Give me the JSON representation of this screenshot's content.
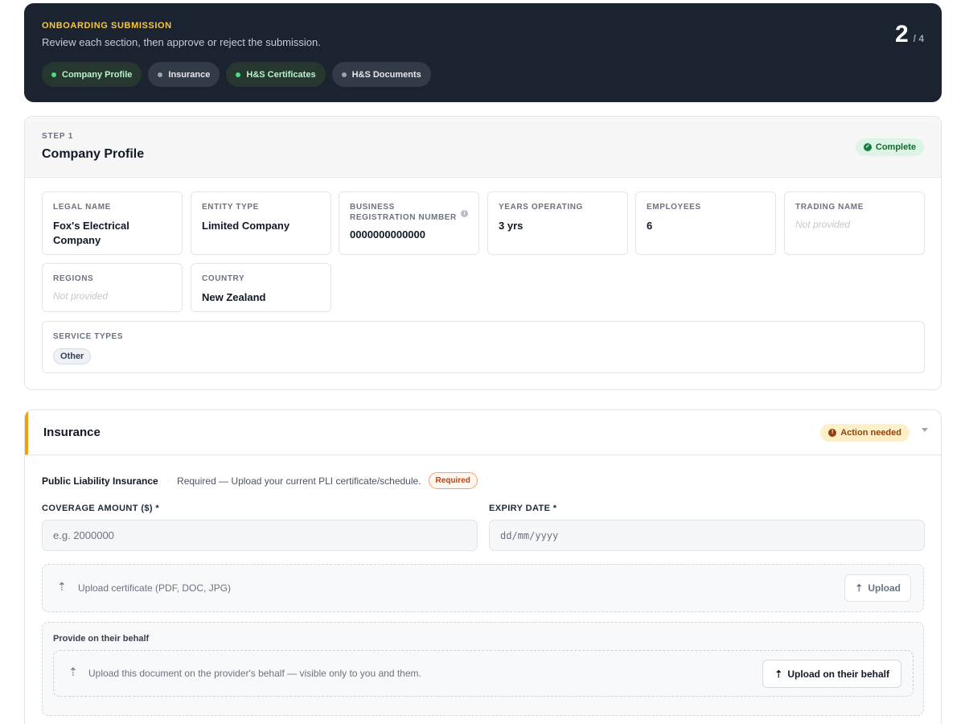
{
  "header": {
    "kicker": "ONBOARDING SUBMISSION",
    "subtitle": "Review each section, then approve or reject the submission.",
    "step_current": "2",
    "step_total": "/ 4",
    "steps": [
      {
        "label": "Company Profile",
        "status": "complete"
      },
      {
        "label": "Insurance",
        "status": "pending"
      },
      {
        "label": "H&S Certificates",
        "status": "complete"
      },
      {
        "label": "H&S Documents",
        "status": "pending"
      }
    ]
  },
  "company_profile": {
    "step_label": "STEP 1",
    "title": "Company Profile",
    "status_badge": "Complete",
    "fields": {
      "legal_name": {
        "label": "LEGAL NAME",
        "value": "Fox's Electrical Company"
      },
      "entity_type": {
        "label": "ENTITY TYPE",
        "value": "Limited Company"
      },
      "business_reg": {
        "label": "BUSINESS REGISTRATION NUMBER",
        "value": "0000000000000"
      },
      "years_operating": {
        "label": "YEARS OPERATING",
        "value": "3 yrs"
      },
      "employees": {
        "label": "EMPLOYEES",
        "value": "6"
      },
      "trading_name": {
        "label": "TRADING NAME",
        "value": "Not provided"
      },
      "regions": {
        "label": "REGIONS",
        "value": "Not provided"
      },
      "country": {
        "label": "COUNTRY",
        "value": "New Zealand"
      },
      "service_types": {
        "label": "SERVICE TYPES",
        "tags": [
          "Other"
        ]
      }
    }
  },
  "insurance": {
    "title": "Insurance",
    "status_badge": "Action needed",
    "pli": {
      "title": "Public Liability Insurance",
      "description": "Required — Upload your current PLI certificate/schedule.",
      "required_badge": "Required"
    },
    "coverage": {
      "label": "COVERAGE AMOUNT ($) *",
      "placeholder": "e.g. 2000000"
    },
    "expiry": {
      "label": "EXPIRY DATE *",
      "placeholder": "dd/mm/yyyy"
    },
    "upload": {
      "hint": "Upload certificate (PDF, DOC, JPG)",
      "button": "Upload"
    },
    "behalf": {
      "title": "Provide on their behalf",
      "hint": "Upload this document on the provider's behalf — visible only to you and them.",
      "button": "Upload on their behalf"
    }
  },
  "icons": {
    "upload": "upload-icon",
    "info": "info-icon",
    "check": "check-circle-icon",
    "alert": "alert-circle-icon",
    "chevron": "chevron-down-icon"
  },
  "colors": {
    "banner_bg": "#1b2230",
    "kicker": "#f6c944",
    "complete": "#166534",
    "action": "#92400e",
    "accent_bar": "#f59e0b"
  }
}
